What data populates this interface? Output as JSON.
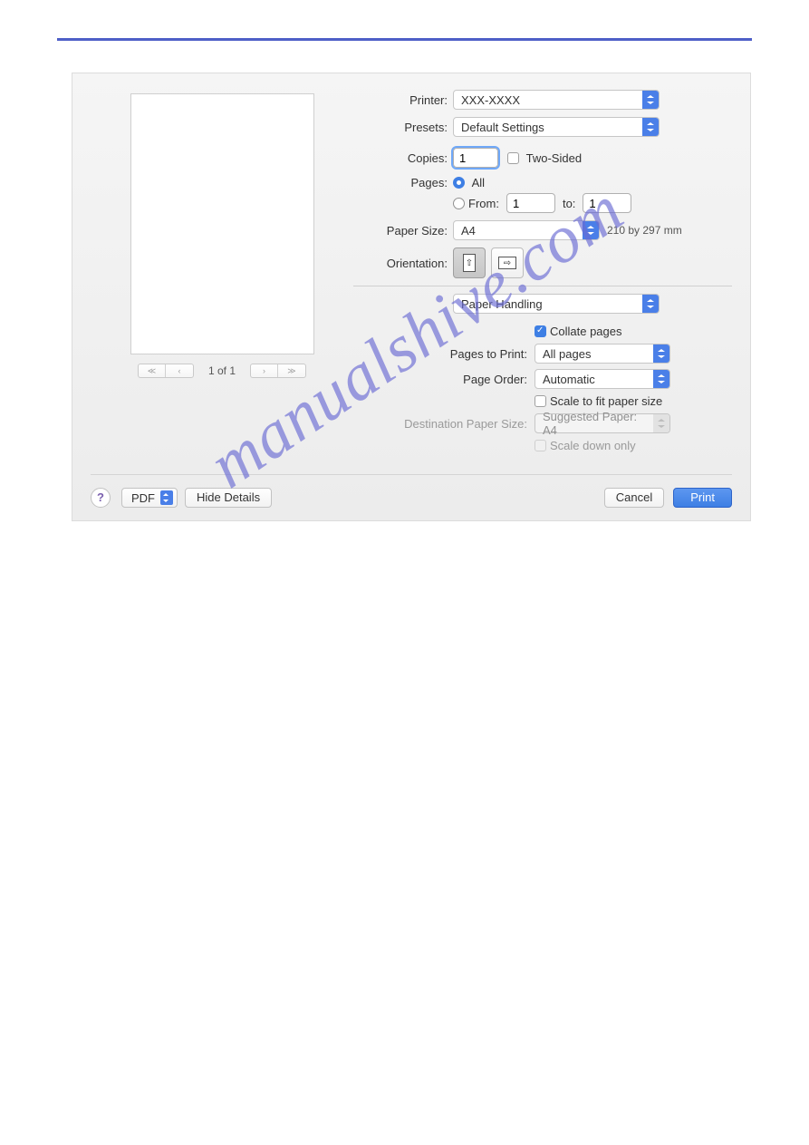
{
  "watermark": "manualshive.com",
  "preview": {
    "pager_label": "1 of 1"
  },
  "printer": {
    "label": "Printer:",
    "value": "XXX-XXXX"
  },
  "presets": {
    "label": "Presets:",
    "value": "Default Settings"
  },
  "copies": {
    "label": "Copies:",
    "value": "1",
    "two_sided_label": "Two-Sided"
  },
  "pages": {
    "label": "Pages:",
    "all_label": "All",
    "from_label": "From:",
    "from_value": "1",
    "to_label": "to:",
    "to_value": "1"
  },
  "paper_size": {
    "label": "Paper Size:",
    "value": "A4",
    "hint": "210 by 297 mm"
  },
  "orientation": {
    "label": "Orientation:"
  },
  "section_select": {
    "value": "Paper Handling"
  },
  "handling": {
    "collate_label": "Collate pages",
    "pages_to_print_label": "Pages to Print:",
    "pages_to_print_value": "All pages",
    "page_order_label": "Page Order:",
    "page_order_value": "Automatic",
    "scale_fit_label": "Scale to fit paper size",
    "dest_size_label": "Destination Paper Size:",
    "dest_size_value": "Suggested Paper: A4",
    "scale_down_label": "Scale down only"
  },
  "footer": {
    "pdf_label": "PDF",
    "hide_details_label": "Hide Details",
    "cancel_label": "Cancel",
    "print_label": "Print"
  }
}
